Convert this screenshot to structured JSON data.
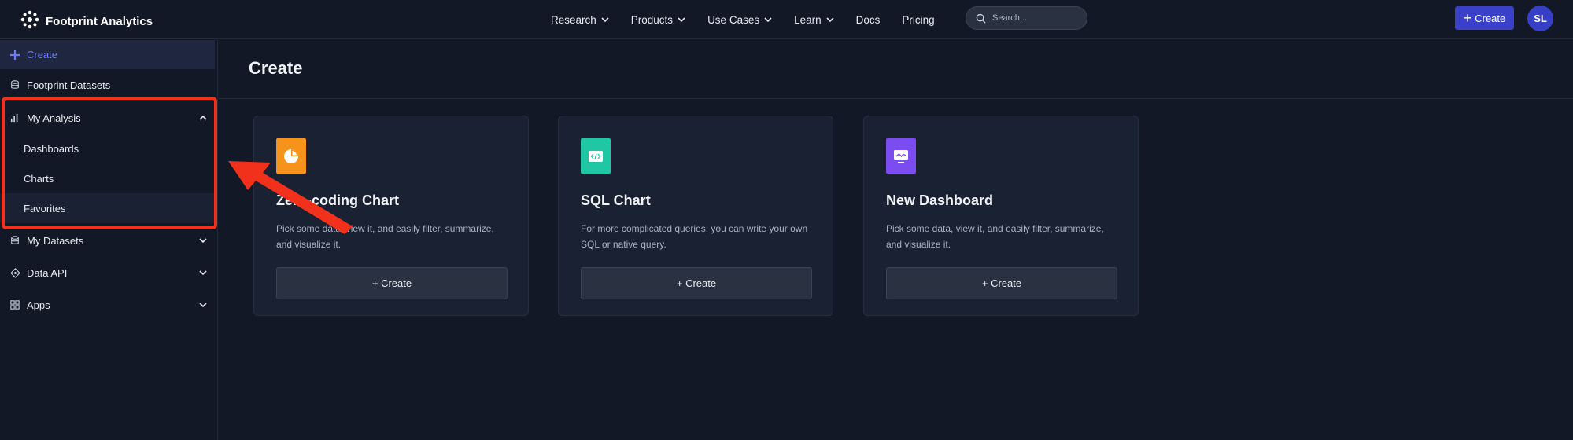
{
  "brand": {
    "name": "Footprint Analytics"
  },
  "nav": {
    "items": [
      {
        "label": "Research",
        "has_dropdown": true
      },
      {
        "label": "Products",
        "has_dropdown": true
      },
      {
        "label": "Use Cases",
        "has_dropdown": true
      },
      {
        "label": "Learn",
        "has_dropdown": true
      },
      {
        "label": "Docs",
        "has_dropdown": false
      },
      {
        "label": "Pricing",
        "has_dropdown": false
      }
    ],
    "search_placeholder": "Search...",
    "create_label": "Create",
    "avatar_initials": "SL"
  },
  "sidebar": {
    "create_label": "Create",
    "datasets_label": "Footprint Datasets",
    "my_analysis": {
      "label": "My Analysis",
      "expanded": true,
      "items": [
        {
          "label": "Dashboards"
        },
        {
          "label": "Charts"
        },
        {
          "label": "Favorites"
        }
      ]
    },
    "my_datasets_label": "My Datasets",
    "data_api_label": "Data API",
    "apps_label": "Apps"
  },
  "main": {
    "title": "Create",
    "cards": [
      {
        "title": "Zero-coding Chart",
        "description": "Pick some data, view it, and easily filter, summarize, and visualize it.",
        "button_label": "+ Create",
        "icon": "pie-chart-icon",
        "icon_color": "#f7931a"
      },
      {
        "title": "SQL Chart",
        "description": "For more complicated queries, you can write your own SQL or native query.",
        "button_label": "+ Create",
        "icon": "code-icon",
        "icon_color": "#1fc7a4"
      },
      {
        "title": "New Dashboard",
        "description": "Pick some data, view it, and easily filter, summarize, and visualize it.",
        "button_label": "+ Create",
        "icon": "dashboard-monitor-icon",
        "icon_color": "#7b4cf0"
      }
    ]
  },
  "colors": {
    "background": "#121826",
    "card": "#1a2132",
    "accent": "#3b40c9",
    "highlight": "#f2311c"
  }
}
